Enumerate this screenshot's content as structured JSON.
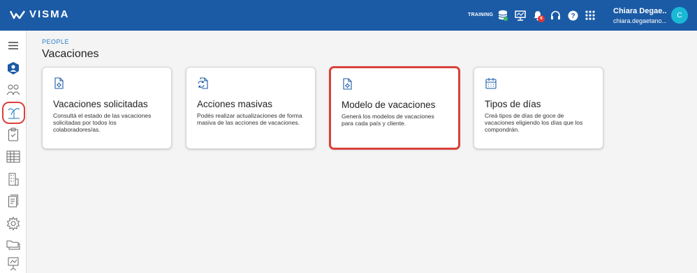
{
  "header": {
    "brand": "VISMA",
    "environment": "TRAINING",
    "notifications_count": "6",
    "user_name": "Chiara Degae...",
    "user_email": "chiara.degaetano...",
    "avatar_initial": "C"
  },
  "icons": {
    "topbar": [
      "database-icon",
      "monitor-icon",
      "bell-icon",
      "headset-icon",
      "help-icon",
      "apps-grid-icon"
    ],
    "sidebar": [
      "menu-icon",
      "profile-icon",
      "people-icon",
      "vacation-icon",
      "clipboard-icon",
      "calendar-table-icon",
      "building-icon",
      "documents-icon",
      "settings-icon",
      "folders-icon",
      "presentation-icon"
    ]
  },
  "breadcrumb": "PEOPLE",
  "page_title": "Vacaciones",
  "cards": [
    {
      "title": "Vacaciones solicitadas",
      "description": "Consultá el estado de las vacaciones solicitadas por todos los colaboradores/as.",
      "icon": "gear-document-icon"
    },
    {
      "title": "Acciones masivas",
      "description": "Podés realizar actualizaciones de forma masiva de las acciones de vacaciones.",
      "icon": "sync-document-icon"
    },
    {
      "title": "Modelo de vacaciones",
      "description": "Generá los modelos de vacaciones para cada país y cliente.",
      "icon": "gear-document-icon"
    },
    {
      "title": "Tipos de días",
      "description": "Creá tipos de días de goce de vacaciones eligiendo los días que los compondrán.",
      "icon": "calendar-icon"
    }
  ],
  "colors": {
    "topbar": "#1b5ba6",
    "accent": "#2a7fc6",
    "highlight": "#d9413a",
    "avatar": "#19b9d6"
  }
}
